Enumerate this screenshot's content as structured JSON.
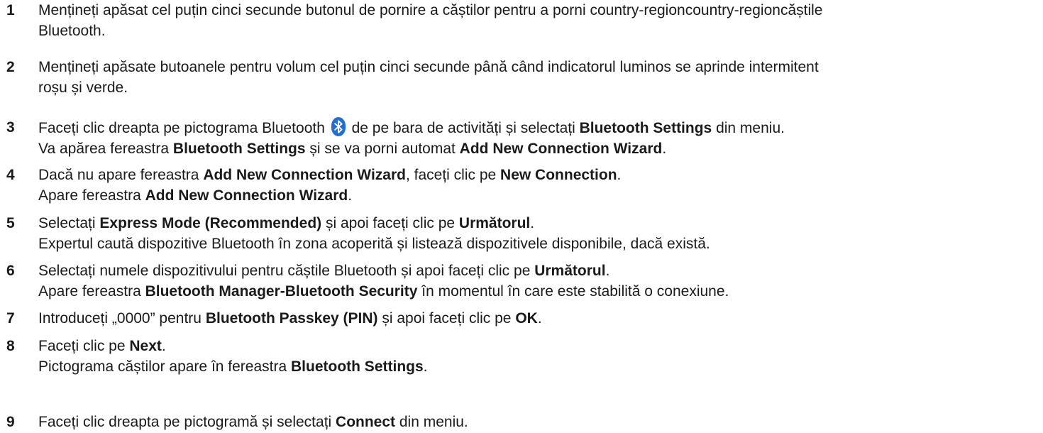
{
  "steps": [
    {
      "number": "1",
      "lines": [
        [
          {
            "t": "Mențineți apăsat cel puțin cinci secunde butonul de pornire a căștilor pentru a porni country-regioncountry-regioncăștile",
            "b": false
          }
        ],
        [
          {
            "t": "Bluetooth.",
            "b": false
          }
        ]
      ]
    },
    {
      "number": "2",
      "lines": [
        [
          {
            "t": "Mențineți apăsate butoanele pentru volum cel puțin cinci secunde până când indicatorul luminos se aprinde intermitent",
            "b": false
          }
        ],
        [
          {
            "t": "roșu și verde.",
            "b": false
          }
        ]
      ]
    },
    {
      "number": "3",
      "lines": [
        [
          {
            "t": "Faceți clic dreapta pe pictograma Bluetooth ",
            "b": false
          },
          {
            "icon": "bluetooth-icon"
          },
          {
            "t": " de pe bara de activități și selectați ",
            "b": false
          },
          {
            "t": "Bluetooth Settings",
            "b": true
          },
          {
            "t": " din meniu.",
            "b": false
          }
        ],
        [
          {
            "t": "Va apărea fereastra ",
            "b": false
          },
          {
            "t": "Bluetooth Settings",
            "b": true
          },
          {
            "t": " și se va porni automat ",
            "b": false
          },
          {
            "t": "Add New Connection Wizard",
            "b": true
          },
          {
            "t": ".",
            "b": false
          }
        ]
      ]
    },
    {
      "number": "4",
      "lines": [
        [
          {
            "t": "Dacă nu apare fereastra ",
            "b": false
          },
          {
            "t": "Add New Connection Wizard",
            "b": true
          },
          {
            "t": ", faceți clic pe ",
            "b": false
          },
          {
            "t": "New Connection",
            "b": true
          },
          {
            "t": ".",
            "b": false
          }
        ],
        [
          {
            "t": "Apare fereastra ",
            "b": false
          },
          {
            "t": "Add New Connection Wizard",
            "b": true
          },
          {
            "t": ".",
            "b": false
          }
        ]
      ]
    },
    {
      "number": "5",
      "lines": [
        [
          {
            "t": "Selectați ",
            "b": false
          },
          {
            "t": "Express Mode (Recommended)",
            "b": true
          },
          {
            "t": " și apoi faceți clic pe ",
            "b": false
          },
          {
            "t": "Următorul",
            "b": true
          },
          {
            "t": ".",
            "b": false
          }
        ],
        [
          {
            "t": "Expertul caută dispozitive Bluetooth în zona acoperită și listează dispozitivele disponibile, dacă există.",
            "b": false
          }
        ]
      ]
    },
    {
      "number": "6",
      "lines": [
        [
          {
            "t": "Selectați numele dispozitivului pentru căștile Bluetooth și apoi faceți clic pe ",
            "b": false
          },
          {
            "t": "Următorul",
            "b": true
          },
          {
            "t": ".",
            "b": false
          }
        ],
        [
          {
            "t": "Apare fereastra ",
            "b": false
          },
          {
            "t": "Bluetooth Manager-Bluetooth Security",
            "b": true
          },
          {
            "t": " în momentul în care este stabilită o conexiune.",
            "b": false
          }
        ]
      ]
    },
    {
      "number": "7",
      "lines": [
        [
          {
            "t": "Introduceți „0000” pentru ",
            "b": false
          },
          {
            "t": "Bluetooth Passkey (PIN)",
            "b": true
          },
          {
            "t": " și apoi faceți clic pe ",
            "b": false
          },
          {
            "t": "OK",
            "b": true
          },
          {
            "t": ".",
            "b": false
          }
        ]
      ]
    },
    {
      "number": "8",
      "lines": [
        [
          {
            "t": "Faceți clic pe ",
            "b": false
          },
          {
            "t": "Next",
            "b": true
          },
          {
            "t": ".",
            "b": false
          }
        ],
        [
          {
            "t": "Pictograma căștilor apare în fereastra ",
            "b": false
          },
          {
            "t": "Bluetooth Settings",
            "b": true
          },
          {
            "t": ".",
            "b": false
          }
        ]
      ]
    },
    {
      "number": "9",
      "lines": [
        [
          {
            "t": "Faceți clic dreapta pe pictogramă și selectați ",
            "b": false
          },
          {
            "t": "Connect",
            "b": true
          },
          {
            "t": " din meniu.",
            "b": false
          }
        ]
      ]
    }
  ],
  "colors": {
    "text": "#1a1a1a",
    "bluetooth_icon_bg": "#1e6fd9",
    "bluetooth_icon_fg": "#ffffff"
  }
}
